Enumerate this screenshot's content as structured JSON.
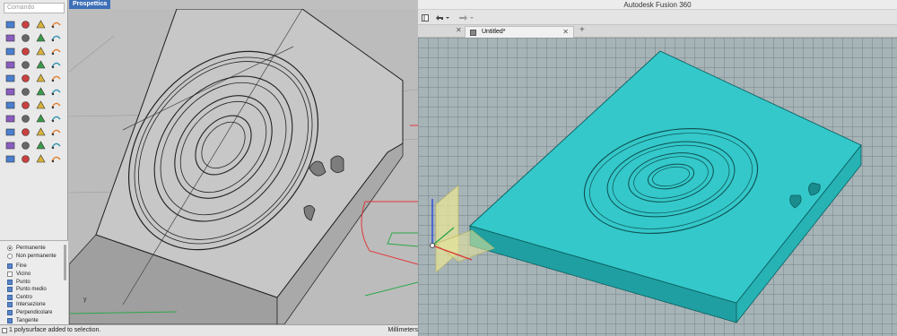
{
  "rhino": {
    "command_placeholder": "Comando",
    "viewport_title": "Prospettica",
    "viewport_axis_label": "y",
    "status_message": "1 polysurface added to selection.",
    "units": "Millimeters",
    "osnap_mode": [
      {
        "label": "Permanente",
        "selected": true
      },
      {
        "label": "Non permanente",
        "selected": false
      }
    ],
    "osnaps": [
      {
        "label": "Fine",
        "checked": true
      },
      {
        "label": "Vicino",
        "checked": false
      },
      {
        "label": "Punto",
        "checked": true
      },
      {
        "label": "Punto medio",
        "checked": true
      },
      {
        "label": "Centro",
        "checked": true
      },
      {
        "label": "Intersezione",
        "checked": true
      },
      {
        "label": "Perpendicolare",
        "checked": true
      },
      {
        "label": "Tangente",
        "checked": true
      }
    ],
    "tool_icons": [
      "select-icon",
      "point-icon",
      "polyline-icon",
      "curve-icon",
      "circle-icon",
      "arc-icon",
      "ellipse-icon",
      "rectangle-icon",
      "polygon-icon",
      "freeform-icon",
      "offset-icon",
      "fillet-icon",
      "surface-icon",
      "loft-icon",
      "sweep-icon",
      "extrude-icon",
      "box-icon",
      "sphere-icon",
      "cylinder-icon",
      "boolean-icon",
      "mesh-icon",
      "transform-icon",
      "rotate-icon",
      "scale-icon",
      "array-icon",
      "mirror-icon",
      "align-icon",
      "trim-icon",
      "split-icon",
      "join-icon",
      "explode-icon",
      "group-icon",
      "layer-icon",
      "analyze-icon",
      "dimension-icon",
      "render-icon",
      "light-icon",
      "camera-icon",
      "grid-icon",
      "settings-icon",
      "color-icon",
      "material-icon",
      "texture-icon",
      "plugin-icon"
    ],
    "colors": {
      "viewport_bg": "#bcbcbc",
      "title_tab": "#3d6fb8",
      "model_face": "#c7c7c7",
      "curve_red": "#e0383a",
      "curve_green": "#2da84a"
    }
  },
  "fusion": {
    "window_title": "Autodesk Fusion 360",
    "document_tab": "Untitled*",
    "colors": {
      "model_face": "#32c6c8",
      "model_side": "#23a9ab",
      "canvas_bg": "#a7b4b7",
      "section_plane": "#e8e69a"
    }
  }
}
